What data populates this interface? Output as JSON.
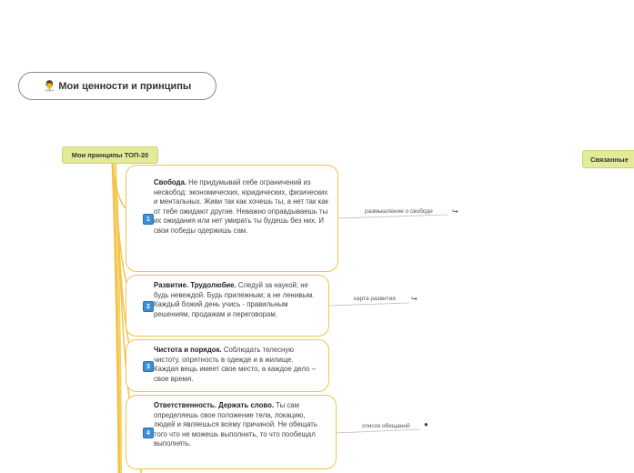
{
  "root": {
    "title": "Мои ценности и принципы",
    "avatar_icon": "man-office-worker-emoji"
  },
  "main_topic": {
    "label": "Мои принципы ТОП-20"
  },
  "side_topic": {
    "label": "Связанные"
  },
  "principles": [
    {
      "number": "1",
      "bold": "Свобода.",
      "text": " Не придумывай себе ограничений из несвобод: экономических, юридических, физических и ментальных. Живи так как хочешь ты, а нет так как от тебя ожидают другие. Неважно оправдываешь ты их ожидания или нет умирать ты будешь без них. И свои победы одержишь сам.",
      "link_label": "размышление о свободе",
      "link_icon": "mindmap-link-icon"
    },
    {
      "number": "2",
      "bold": "Развитие. Трудолюбие.",
      "text": " Следуй за наукой; не будь невеждой. Будь прилежным; а не ленивым. Каждый божий день учись - правильным решениям, продажам и переговорам.",
      "link_label": "карта развития",
      "link_icon": "mindmap-link-icon"
    },
    {
      "number": "3",
      "bold": "Чистота и порядок.",
      "text": " Соблюдать телесную чистоту, опрятность в одежде и в жилище. Каждая вещь имеет свое место, а каждое дело – свое время.",
      "link_label": "",
      "link_icon": ""
    },
    {
      "number": "4",
      "bold": "Ответственность. Держать слово.",
      "text": " Ты сам определяешь свое положение тела, локацию, людей и являешься всему причиной. Не обещать того что не можешь выполнить, то что пообещал выполнять.",
      "link_label": "список обещаний",
      "link_icon": "apple-icon"
    }
  ]
}
